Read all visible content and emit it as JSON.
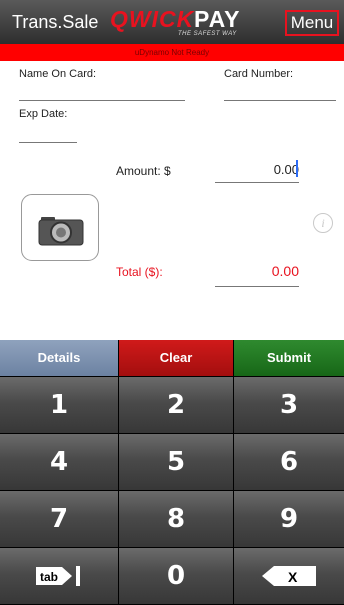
{
  "header": {
    "title": "Trans.Sale",
    "logo_brand": "QwickPAY",
    "logo_tagline": "THE SAFEST WAY",
    "menu_label": "Menu"
  },
  "status": {
    "text": "uDynamo Not Ready"
  },
  "form": {
    "name_label": "Name On Card:",
    "card_label": "Card Number:",
    "exp_label": "Exp Date:",
    "amount_label": "Amount: $",
    "amount_value": "0.00",
    "total_label": "Total ($):",
    "total_value": "0.00"
  },
  "keypad": {
    "details": "Details",
    "clear": "Clear",
    "submit": "Submit",
    "keys": [
      "1",
      "2",
      "3",
      "4",
      "5",
      "6",
      "7",
      "8",
      "9"
    ],
    "zero": "0",
    "tab_label": "tab",
    "backspace_label": "X"
  },
  "colors": {
    "accent": "#e8121f",
    "submit": "#1d7a1d",
    "details": "#7b8fb0"
  }
}
